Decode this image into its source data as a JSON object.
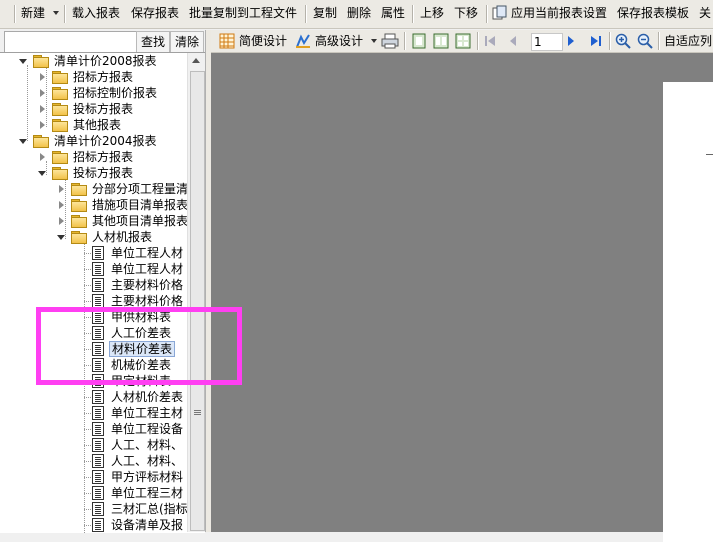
{
  "toolbar": {
    "new": "新建",
    "load_report": "载入报表",
    "save_report": "保存报表",
    "batch_copy": "批量复制到工程文件",
    "copy": "复制",
    "delete": "删除",
    "properties": "属性",
    "move_up": "上移",
    "move_down": "下移",
    "apply_current": "应用当前报表设置",
    "save_template": "保存报表模板",
    "close": "关"
  },
  "search": {
    "find": "查找",
    "clear": "清除",
    "value": ""
  },
  "viewer": {
    "simple_design": "简便设计",
    "advanced_design": "高级设计",
    "page": "1",
    "fit_column": "自适应列"
  },
  "tree": {
    "g2008": "清单计价2008报表",
    "g2008_tender": "招标方报表",
    "g2008_control": "招标控制价报表",
    "g2008_bid": "投标方报表",
    "g2008_other": "其他报表",
    "g2004": "清单计价2004报表",
    "g2004_tender": "招标方报表",
    "g2004_bid": "投标方报表",
    "sub1": "分部分项工程量清",
    "sub2": "措施项目清单报表",
    "sub3": "其他项目清单报表",
    "sub4": "人材机报表",
    "items": [
      "单位工程人材",
      "单位工程人材",
      "主要材料价格",
      "主要材料价格",
      "甲供材料表",
      "人工价差表",
      "材料价差表",
      "机械价差表",
      "甲定材料表",
      "人材机价差表",
      "单位工程主材",
      "单位工程设备",
      "人工、材料、",
      "人工、材料、",
      "甲方评标材料",
      "单位工程三材",
      "三材汇总(指标",
      "设备清单及报"
    ]
  }
}
